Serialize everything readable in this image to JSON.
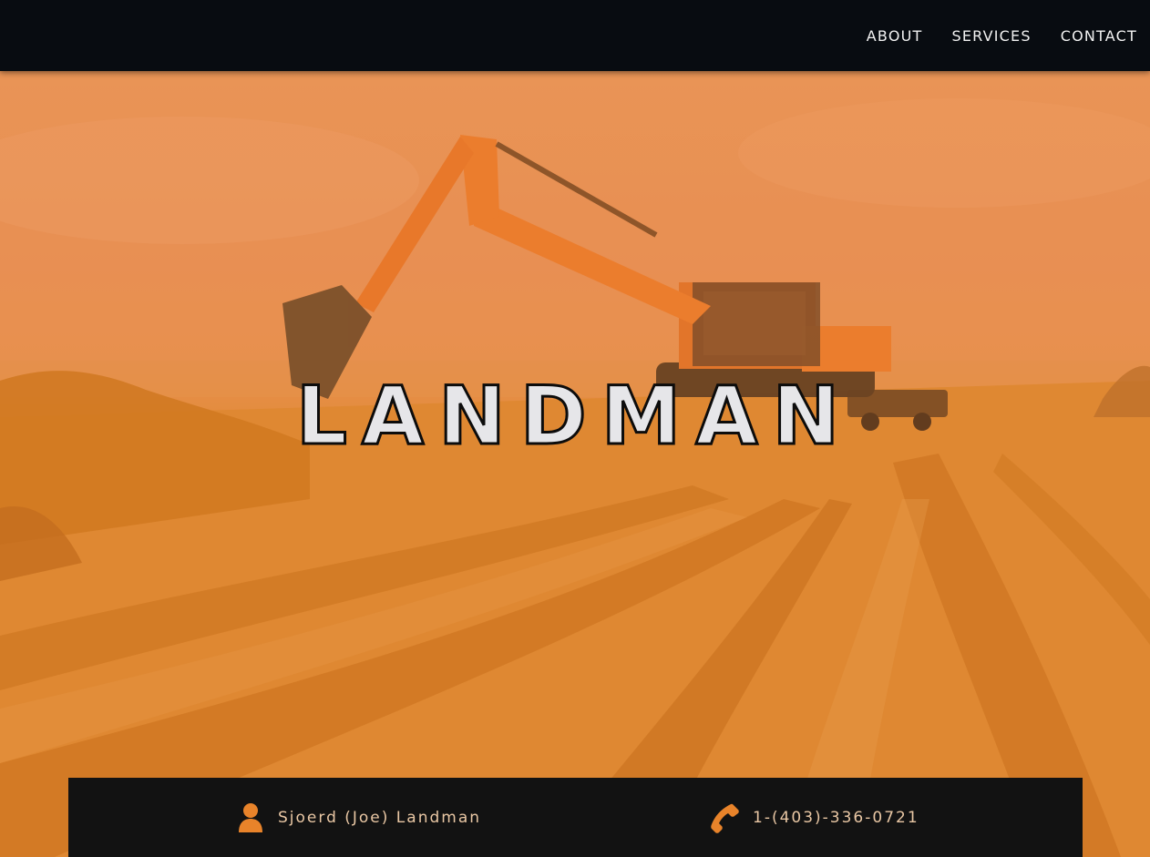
{
  "nav": {
    "items": [
      {
        "label": "ABOUT"
      },
      {
        "label": "SERVICES"
      },
      {
        "label": "CONTACT"
      }
    ]
  },
  "hero": {
    "title": "LANDMAN"
  },
  "contact": {
    "name": "Sjoerd (Joe) Landman",
    "phone": "1-(403)-336-0721",
    "person_icon": "person-icon",
    "phone_icon": "phone-icon"
  },
  "colors": {
    "accent": "#e8832a",
    "topbar": "#080c11",
    "contact_bar": "#121212"
  }
}
